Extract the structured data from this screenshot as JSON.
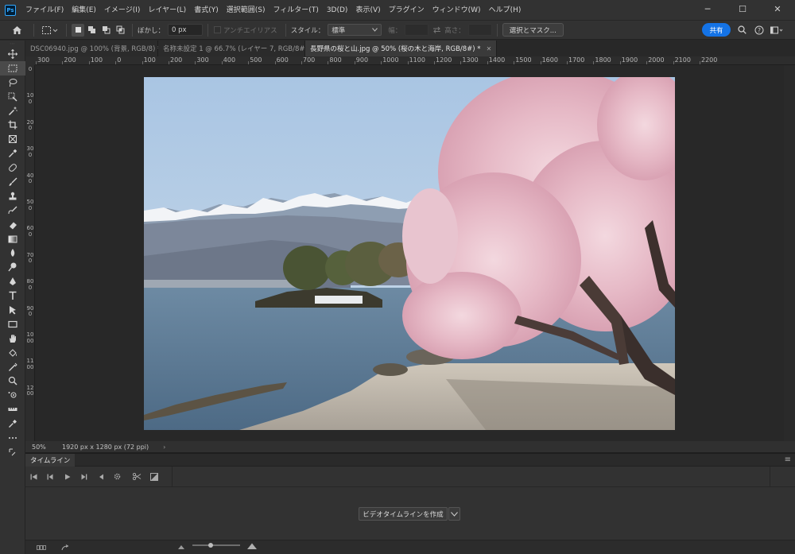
{
  "app": {
    "logo_text": "Ps",
    "menu": [
      "ファイル(F)",
      "編集(E)",
      "イメージ(I)",
      "レイヤー(L)",
      "書式(Y)",
      "選択範囲(S)",
      "フィルター(T)",
      "3D(D)",
      "表示(V)",
      "プラグイン",
      "ウィンドウ(W)",
      "ヘルプ(H)"
    ],
    "window_controls": {
      "minimize": "─",
      "maximize": "☐",
      "close": "✕"
    }
  },
  "options": {
    "feather_label": "ぼかし：",
    "feather_value": "0 px",
    "antialias_label": "アンチエイリアス",
    "style_label": "スタイル：",
    "style_value": "標準",
    "width_label": "幅：",
    "height_label": "高さ：",
    "select_mask_label": "選択とマスク...",
    "share_label": "共有"
  },
  "tabs": [
    {
      "label": "DSC06940.jpg @ 100% (背景, RGB/8) *",
      "active": false
    },
    {
      "label": "名称未設定 1 @ 66.7% (レイヤー 7, RGB/8#) *",
      "active": false
    },
    {
      "label": "長野県の桜と山.jpg @ 50% (桜の木と海岸, RGB/8#) *",
      "active": true
    }
  ],
  "ruler_top": [
    "300",
    "200",
    "100",
    "0",
    "100",
    "200",
    "300",
    "400",
    "500",
    "600",
    "700",
    "800",
    "900",
    "1000",
    "1100",
    "1200",
    "1300",
    "1400",
    "1500",
    "1600",
    "1700",
    "1800",
    "1900",
    "2000",
    "2100",
    "2200"
  ],
  "ruler_left": [
    "0",
    "100",
    "200",
    "300",
    "400",
    "500",
    "600",
    "700",
    "800",
    "900",
    "1000",
    "1100",
    "1200"
  ],
  "status": {
    "zoom": "50%",
    "doc_info": "1920 px x 1280 px (72 ppi)",
    "arrow": "›"
  },
  "timeline": {
    "tab_label": "タイムライン",
    "create_button": "ビデオタイムラインを作成"
  },
  "colors": {
    "accent": "#1473e6",
    "panel": "#323232",
    "canvas_bg": "#282828"
  }
}
